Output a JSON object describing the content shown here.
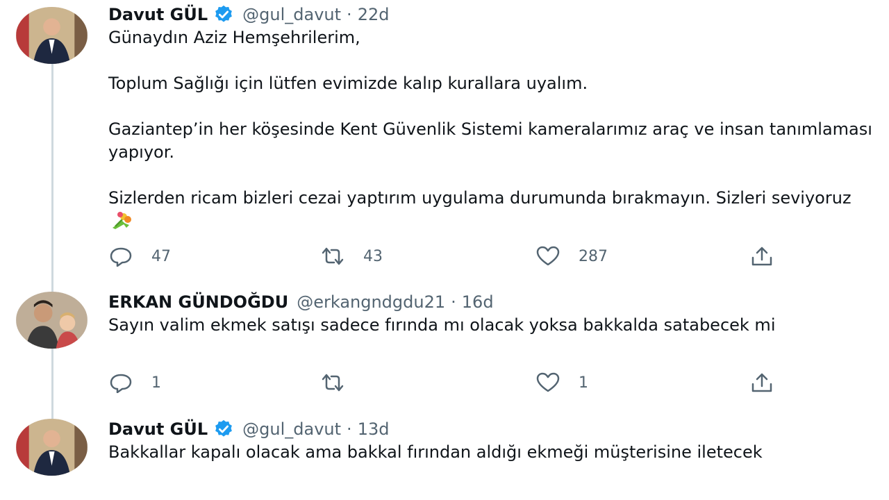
{
  "tweets": [
    {
      "name": "Davut GÜL",
      "handle": "@gul_davut",
      "time": "22d",
      "paragraphs": [
        "Günaydın Aziz Hemşehrilerim,",
        "Toplum Sağlığı için lütfen evimizde kalıp kurallara uyalım.",
        "Gaziantep’in her köşesinde Kent Güvenlik Sistemi kameralarımız araç ve insan tanımlaması yapıyor.",
        "Sizlerden ricam bizleri cezai yaptırım uygulama durumunda bırakmayın. Sizleri seviyoruz"
      ],
      "emoji": "bouquet-emoji",
      "replies": "47",
      "retweets": "43",
      "likes": "287"
    },
    {
      "name": "ERKAN GÜNDOĞDU",
      "handle": "@erkangndgdu21",
      "time": "16d",
      "text": "Sayın valim ekmek satışı sadece fırında mı olacak yoksa bakkalda satabecek mi",
      "replies": "1",
      "retweets": "",
      "likes": "1"
    },
    {
      "name": "Davut GÜL",
      "handle": "@gul_davut",
      "time": "13d",
      "text": "Bakkallar kapalı olacak ama bakkal fırından aldığı ekmeği müşterisine iletecek"
    }
  ],
  "separator": "·",
  "colors": {
    "verified": "#1d9bf0",
    "muted": "#536471",
    "text": "#0f1419",
    "thread_line": "#cfd9de"
  }
}
